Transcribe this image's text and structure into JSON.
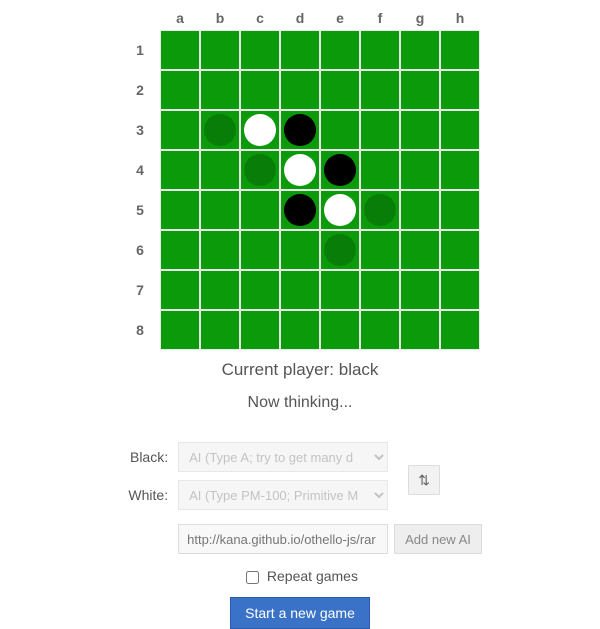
{
  "columns": [
    "a",
    "b",
    "c",
    "d",
    "e",
    "f",
    "g",
    "h"
  ],
  "rows": [
    "1",
    "2",
    "3",
    "4",
    "5",
    "6",
    "7",
    "8"
  ],
  "board": [
    [
      "",
      "",
      "",
      "",
      "",
      "",
      "",
      ""
    ],
    [
      "",
      "",
      "",
      "",
      "",
      "",
      "",
      ""
    ],
    [
      "",
      "hint",
      "white",
      "black",
      "",
      "",
      "",
      ""
    ],
    [
      "",
      "",
      "hint",
      "white",
      "black",
      "",
      "",
      ""
    ],
    [
      "",
      "",
      "",
      "black",
      "white",
      "hint",
      "",
      ""
    ],
    [
      "",
      "",
      "",
      "",
      "hint",
      "",
      "",
      ""
    ],
    [
      "",
      "",
      "",
      "",
      "",
      "",
      "",
      ""
    ],
    [
      "",
      "",
      "",
      "",
      "",
      "",
      "",
      ""
    ]
  ],
  "status": "Current player: black",
  "thinking": "Now thinking...",
  "black_label": "Black:",
  "white_label": "White:",
  "black_ai": "AI (Type A; try to get many d",
  "white_ai": "AI (Type PM-100; Primitive M",
  "swap_glyph": "⇅",
  "url_placeholder": "http://kana.github.io/othello-js/rar",
  "add_ai_label": "Add new AI",
  "repeat_label": "Repeat games",
  "start_label": "Start a new game"
}
